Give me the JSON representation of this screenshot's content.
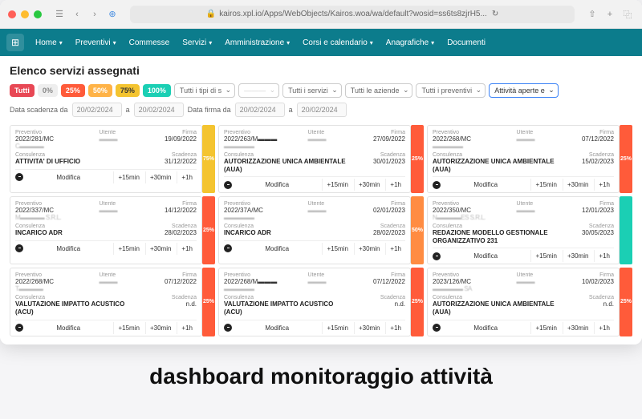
{
  "url": "kairos.xpl.io/Apps/WebObjects/Kairos.woa/wa/default?wosid=ss6ts8zjrH5...",
  "nav": [
    {
      "label": "Home",
      "caret": true
    },
    {
      "label": "Preventivi",
      "caret": true
    },
    {
      "label": "Commesse",
      "caret": false
    },
    {
      "label": "Servizi",
      "caret": true
    },
    {
      "label": "Amministrazione",
      "caret": true
    },
    {
      "label": "Corsi e calendario",
      "caret": true
    },
    {
      "label": "Anagrafiche",
      "caret": true
    },
    {
      "label": "Documenti",
      "caret": false
    }
  ],
  "page_title": "Elenco servizi assegnati",
  "pills": {
    "all": "Tutti",
    "p0": "0%",
    "p25": "25%",
    "p50": "50%",
    "p75": "75%",
    "p100": "100%"
  },
  "filters": {
    "tipo": "Tutti i tipi di s",
    "blurred": "———",
    "servizi": "Tutti i servizi",
    "aziende": "Tutti le aziende",
    "preventivi": "Tutti i preventivi",
    "attivita": "Attività aperte e"
  },
  "date_labels": {
    "scad_da": "Data scadenza da",
    "a": "a",
    "firma_da": "Data firma da"
  },
  "date_values": {
    "d1": "20/02/2024",
    "d2": "20/02/2024",
    "d3": "20/02/2024",
    "d4": "20/02/2024"
  },
  "card_labels": {
    "prev": "Preventivo",
    "utente": "Utente",
    "firma": "Firma",
    "consul": "Consulenza",
    "scad": "Scadenza",
    "modifica": "Modifica",
    "p15": "+15min",
    "p30": "+30min",
    "p1h": "+1h"
  },
  "cards": [
    {
      "prev": "2022/281/MC",
      "cli": "C▬▬▬▬",
      "firma": "19/09/2022",
      "act": "ATTIVITA' DI UFFICIO",
      "scad": "31/12/2022",
      "badge": "75",
      "bclass": "p75"
    },
    {
      "prev": "2022/263/M▬▬▬",
      "cli": "▬▬▬▬▬",
      "firma": "27/09/2022",
      "act": "AUTORIZZAZIONE UNICA AMBIENTALE (AUA)",
      "scad": "30/01/2023",
      "badge": "25",
      "bclass": "p25"
    },
    {
      "prev": "2022/268/MC",
      "cli": "▬▬▬▬▬",
      "firma": "07/12/2022",
      "act": "AUTORIZZAZIONE UNICA AMBIENTALE (AUA)",
      "scad": "15/02/2023",
      "badge": "25",
      "bclass": "p25"
    },
    {
      "prev": "2022/337/MC",
      "cli": "M▬▬▬▬ S.R.L.",
      "firma": "14/12/2022",
      "act": "INCARICO ADR",
      "scad": "28/02/2023",
      "badge": "25",
      "bclass": "p25"
    },
    {
      "prev": "2022/37A/MC",
      "cli": "▬▬▬▬▬",
      "firma": "02/01/2023",
      "act": "INCARICO ADR",
      "scad": "28/02/2023",
      "badge": "50",
      "bclass": "p50"
    },
    {
      "prev": "2022/350/MC",
      "cli": "N▬▬▬▬ES S.R.L.",
      "firma": "12/01/2023",
      "act": "REDAZIONE MODELLO GESTIONALE ORGANIZZATIVO 231",
      "scad": "30/05/2023",
      "badge": "",
      "bclass": "done"
    },
    {
      "prev": "2022/268/MC",
      "cli": "T▬▬▬▬",
      "firma": "07/12/2022",
      "act": "VALUTAZIONE IMPATTO ACUSTICO (ACU)",
      "scad": "n.d.",
      "badge": "25",
      "bclass": "p25"
    },
    {
      "prev": "2022/268/M▬▬▬",
      "cli": "▬▬▬▬▬",
      "firma": "07/12/2022",
      "act": "VALUTAZIONE IMPATTO ACUSTICO (ACU)",
      "scad": "n.d.",
      "badge": "25",
      "bclass": "p25"
    },
    {
      "prev": "2023/126/MC",
      "cli": "▬▬▬▬▬ SA",
      "firma": "10/02/2023",
      "act": "AUTORIZZAZIONE UNICA AMBIENTALE (AUA)",
      "scad": "n.d.",
      "badge": "25",
      "bclass": "p25"
    }
  ],
  "caption": "dashboard monitoraggio attività"
}
